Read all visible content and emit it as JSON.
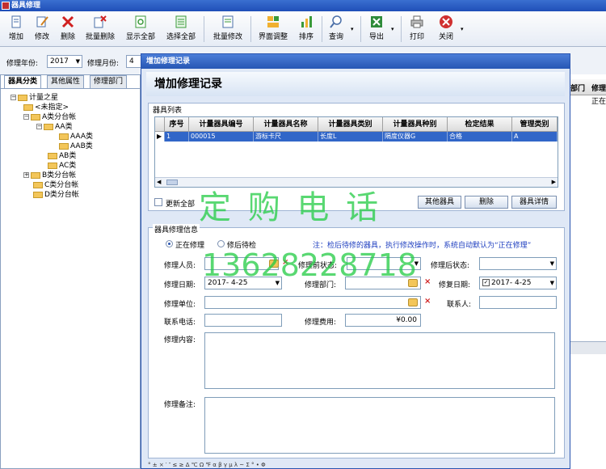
{
  "window": {
    "title": "器具修理"
  },
  "toolbar": {
    "buttons": [
      {
        "label": "增加",
        "icon": "add-document-icon"
      },
      {
        "label": "修改",
        "icon": "edit-icon"
      },
      {
        "label": "删除",
        "icon": "delete-x-icon"
      },
      {
        "label": "批量删除",
        "icon": "batch-delete-icon"
      },
      {
        "label": "显示全部",
        "icon": "refresh-icon"
      },
      {
        "label": "选择全部",
        "icon": "select-all-icon"
      },
      {
        "label": "批量修改",
        "icon": "batch-edit-icon"
      },
      {
        "label": "界面调整",
        "icon": "layout-icon"
      },
      {
        "label": "排序",
        "icon": "sort-icon"
      },
      {
        "label": "查询",
        "icon": "search-icon"
      },
      {
        "label": "导出",
        "icon": "excel-export-icon"
      },
      {
        "label": "打印",
        "icon": "printer-icon"
      },
      {
        "label": "关闭",
        "icon": "close-circle-icon"
      }
    ]
  },
  "filter": {
    "year_label": "修理年份:",
    "year_value": "2017",
    "month_label": "修理月份:",
    "month_value": "4"
  },
  "left_panel": {
    "tabs": [
      "器具分类",
      "其他属性",
      "修理部门"
    ],
    "tree": [
      {
        "label": "计量之星",
        "level": 0,
        "toggle": "−"
      },
      {
        "label": "<未指定>",
        "level": 1,
        "toggle": ""
      },
      {
        "label": "A类分台帐",
        "level": 1,
        "toggle": "−"
      },
      {
        "label": "AA类",
        "level": 2,
        "toggle": "−"
      },
      {
        "label": "AAA类",
        "level": 3,
        "toggle": ""
      },
      {
        "label": "AAB类",
        "level": 3,
        "toggle": ""
      },
      {
        "label": "AB类",
        "level": 2,
        "toggle": ""
      },
      {
        "label": "AC类",
        "level": 2,
        "toggle": ""
      },
      {
        "label": "B类分台帐",
        "level": 1,
        "toggle": "+"
      },
      {
        "label": "C类分台帐",
        "level": 1,
        "toggle": ""
      },
      {
        "label": "D类分台帐",
        "level": 1,
        "toggle": ""
      }
    ]
  },
  "background_table": {
    "headers": [
      "部门",
      "修理"
    ],
    "cell": "正在"
  },
  "dialog": {
    "title": "增加修理记录",
    "heading": "增加修理记录",
    "list_group_label": "器具列表",
    "grid": {
      "columns": [
        "序号",
        "计量器具编号",
        "计量器具名称",
        "计量器具类别",
        "计量器具种别",
        "检定结果",
        "管理类别"
      ],
      "rows": [
        [
          "1",
          "000015",
          "游标卡尺",
          "长度L",
          "隔度仪器G",
          "合格",
          "A"
        ]
      ]
    },
    "update_all_label": "更新全部",
    "grid_buttons": [
      "其他器具",
      "删除",
      "器具详情"
    ],
    "repair_group_label": "器具修理信息",
    "radio_repairing": "正在修理",
    "radio_after": "修后待检",
    "note": "注：检后待修的器具，执行修改操作时，系统自动默认为“正在修理”",
    "fields": {
      "repairer_label": "修理人员:",
      "before_status_label": "修理前状态:",
      "after_status_label": "修理后状态:",
      "repair_date_label": "修理日期:",
      "repair_date_value": "2017- 4-25",
      "repair_dept_label": "修理部门:",
      "restore_date_label": "修复日期:",
      "restore_date_value": "2017- 4-25",
      "repair_unit_label": "修理单位:",
      "contact_label": "联系人:",
      "phone_label": "联系电话:",
      "cost_label": "修理费用:",
      "cost_value": "¥0.00",
      "content_label": "修理内容:",
      "remark_label": "修理备注:"
    },
    "bottom_symbols": "° ± × ′ ″ ≤ ≥ Δ ℃ Ω ℉ α β γ μ λ ~ Σ ° • Φ"
  },
  "watermark": {
    "line1": "定 购 电 话",
    "line2": "13628228718"
  },
  "colors": {
    "accent": "#2a55b0",
    "selection": "#3166c8",
    "watermark": "#22cc44",
    "error_x": "#d02020"
  }
}
